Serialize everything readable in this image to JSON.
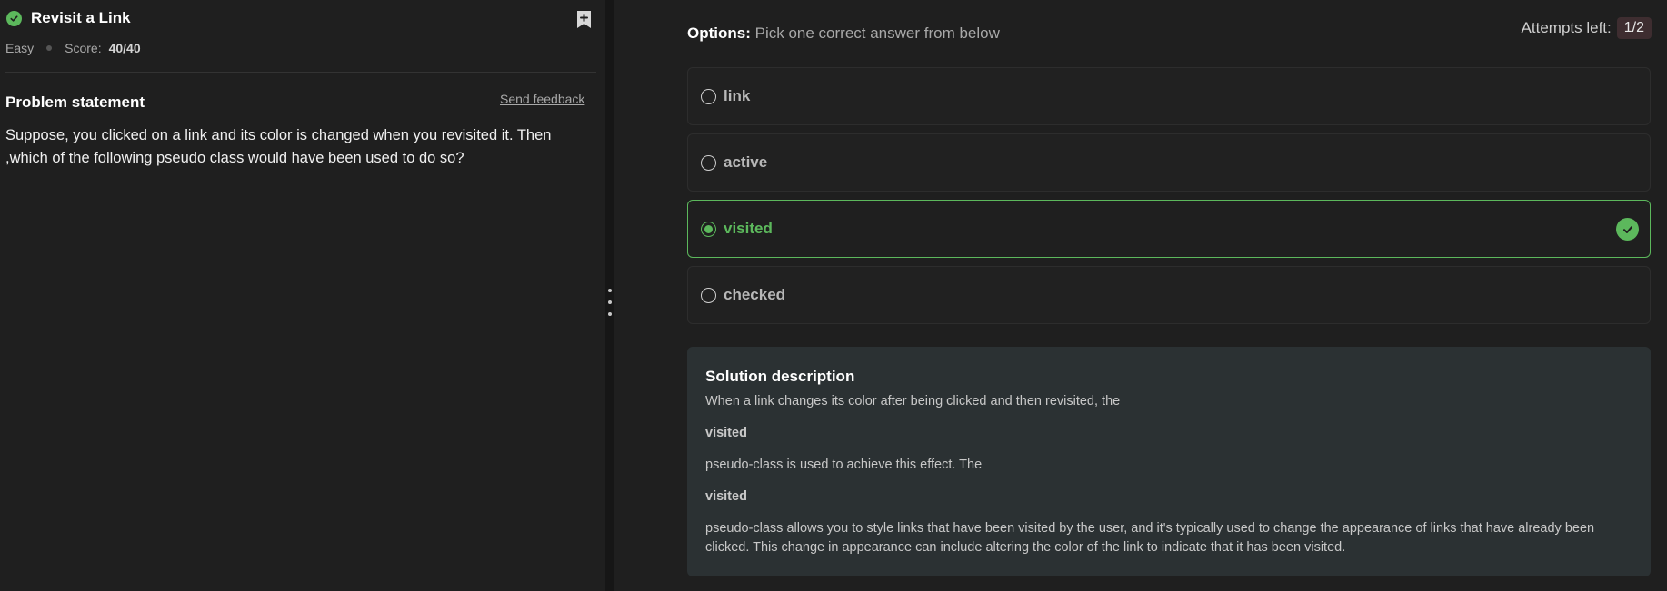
{
  "problem": {
    "title": "Revisit a Link",
    "difficulty": "Easy",
    "score_label": "Score:",
    "score_value": "40/40",
    "statement_heading": "Problem statement",
    "feedback_link": "Send feedback",
    "statement": "Suppose, you clicked on a link and its color is changed when you revisited it. Then ,which of the following pseudo class would have been used to do so?"
  },
  "options_header": {
    "label": "Options:",
    "instruction": "Pick one correct answer from below",
    "attempts_label": "Attempts left:",
    "attempts_value": "1/2"
  },
  "options": [
    {
      "label": "link",
      "selected": false
    },
    {
      "label": "active",
      "selected": false
    },
    {
      "label": "visited",
      "selected": true,
      "correct": true
    },
    {
      "label": "checked",
      "selected": false
    }
  ],
  "solution": {
    "heading": "Solution description",
    "line1": "When a link changes its color after being clicked and then revisited, the",
    "bold1": "visited",
    "line2": "pseudo-class is used to achieve this effect. The",
    "bold2": "visited",
    "line3": "pseudo-class allows you to style links that have been visited by the user, and it's typically used to change the appearance of links that have already been clicked. This change in appearance can include altering the color of the link to indicate that it has been visited."
  },
  "colors": {
    "accent_green": "#5cb85c",
    "background": "#1f1f1f",
    "solution_bg": "#2b3133"
  }
}
